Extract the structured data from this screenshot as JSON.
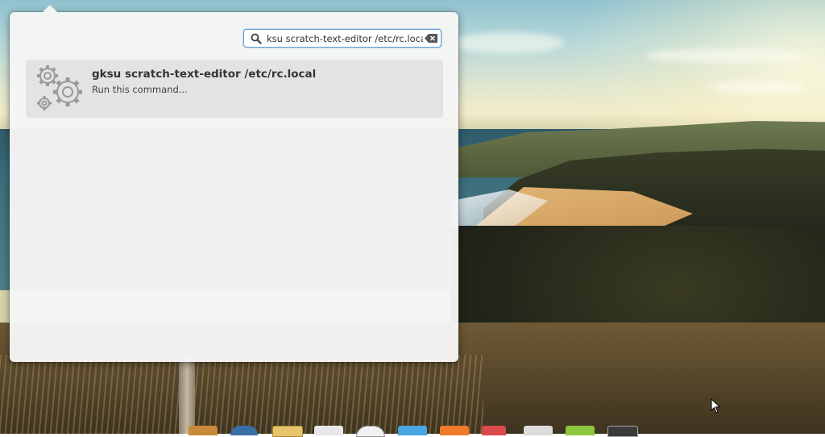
{
  "launcher": {
    "search": {
      "value": "ksu scratch-text-editor /etc/rc.local",
      "icon": "search-icon",
      "clear_icon": "clear-text-icon"
    },
    "results": [
      {
        "icon": "gears-icon",
        "title": "gksu scratch-text-editor /etc/rc.local",
        "subtitle": "Run this command..."
      }
    ]
  },
  "dock": {
    "icons": [
      "files-icon",
      "browser-icon",
      "notes-icon",
      "mail-icon",
      "clock-icon",
      "app-store-icon",
      "music-icon",
      "calendar-icon",
      "photos-icon",
      "android-icon",
      "terminal-icon"
    ]
  },
  "colors": {
    "accent_border": "#6a9fd6",
    "panel_background": "#f5f5f5",
    "result_highlight": "#e3e3e3"
  }
}
